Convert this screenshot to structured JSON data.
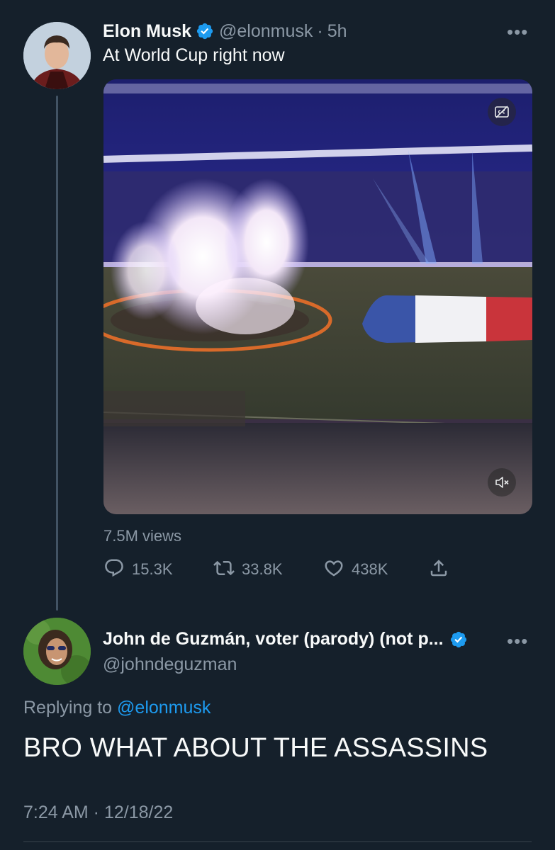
{
  "tweet": {
    "author_name": "Elon Musk",
    "handle": "@elonmusk",
    "time_sep": "·",
    "age": "5h",
    "text": "At World Cup right now",
    "views": "7.5M views",
    "stats": {
      "replies": "15.3K",
      "retweets": "33.8K",
      "likes": "438K"
    }
  },
  "reply": {
    "author_name": "John de Guzmán, voter (parody) (not p...",
    "handle": "@johndeguzman",
    "replying_prefix": "Replying to",
    "replying_handle": "@elonmusk",
    "text": "BRO WHAT ABOUT THE ASSASSINS",
    "timestamp": "7:24 AM · 12/18/22"
  },
  "menu_glyph": "•••",
  "colors": {
    "background": "#15202b",
    "link": "#1d9bf0",
    "secondary_text": "#8b98a5",
    "verified": "#1d9bf0"
  },
  "icons": [
    "verified-badge-icon",
    "more-icon",
    "closed-captions-icon",
    "mute-icon",
    "reply-icon",
    "retweet-icon",
    "like-icon",
    "share-icon"
  ]
}
